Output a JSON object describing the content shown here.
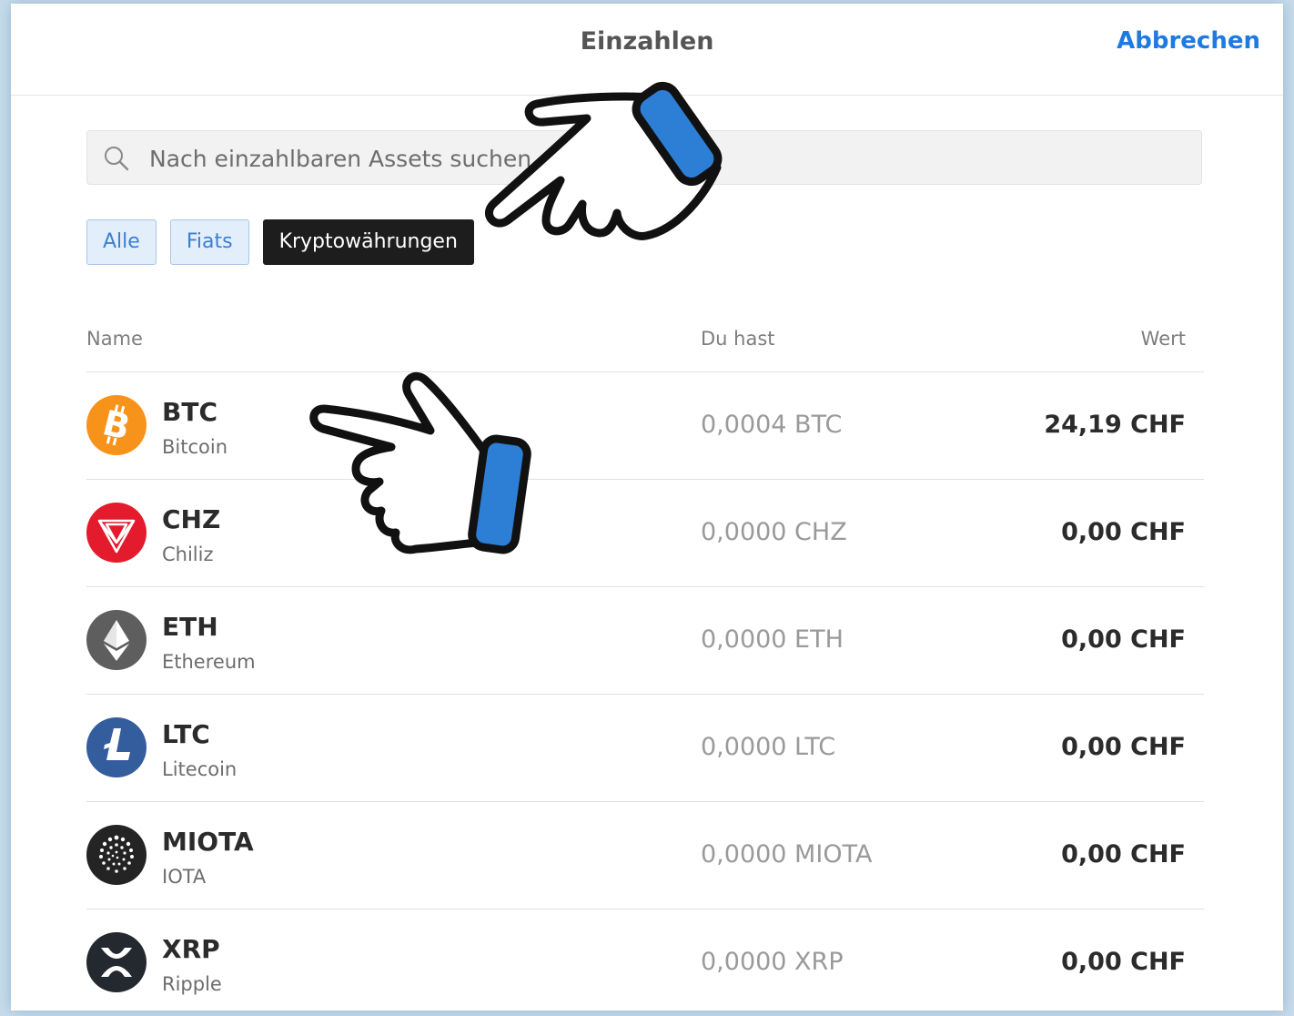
{
  "header": {
    "title": "Einzahlen",
    "cancel_label": "Abbrechen"
  },
  "search": {
    "placeholder": "Nach einzahlbaren Assets suchen"
  },
  "filters": [
    {
      "label": "Alle",
      "active": false
    },
    {
      "label": "Fiats",
      "active": false
    },
    {
      "label": "Kryptowährungen",
      "active": true
    }
  ],
  "table": {
    "columns": {
      "name": "Name",
      "have": "Du hast",
      "value": "Wert"
    },
    "rows": [
      {
        "symbol": "BTC",
        "name": "Bitcoin",
        "balance": "0,0004 BTC",
        "value": "24,19 CHF",
        "icon": "bitcoin-icon",
        "color": "#f7931a"
      },
      {
        "symbol": "CHZ",
        "name": "Chiliz",
        "balance": "0,0000 CHZ",
        "value": "0,00 CHF",
        "icon": "chiliz-icon",
        "color": "#e41b2c"
      },
      {
        "symbol": "ETH",
        "name": "Ethereum",
        "balance": "0,0000 ETH",
        "value": "0,00 CHF",
        "icon": "ethereum-icon",
        "color": "#5e5e5e"
      },
      {
        "symbol": "LTC",
        "name": "Litecoin",
        "balance": "0,0000 LTC",
        "value": "0,00 CHF",
        "icon": "litecoin-icon",
        "color": "#345d9d"
      },
      {
        "symbol": "MIOTA",
        "name": "IOTA",
        "balance": "0,0000 MIOTA",
        "value": "0,00 CHF",
        "icon": "iota-icon",
        "color": "#242424"
      },
      {
        "symbol": "XRP",
        "name": "Ripple",
        "balance": "0,0000 XRP",
        "value": "0,00 CHF",
        "icon": "ripple-icon",
        "color": "#23292f"
      }
    ]
  },
  "colors": {
    "accent": "#1f7ae0",
    "hand_cuff": "#2d7fd6"
  }
}
